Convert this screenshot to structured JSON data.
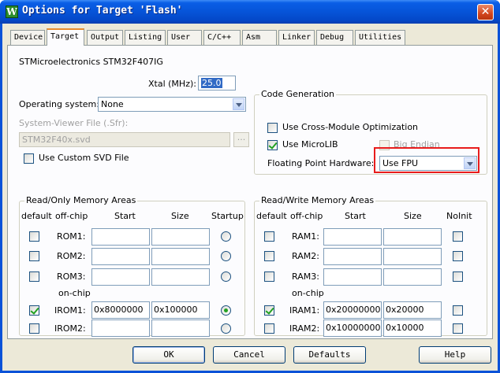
{
  "window": {
    "title": "Options for Target 'Flash'",
    "app_icon_letter": "W",
    "close_glyph": "✕"
  },
  "tabs": [
    "Device",
    "Target",
    "Output",
    "Listing",
    "User",
    "C/C++",
    "Asm",
    "Linker",
    "Debug",
    "Utilities"
  ],
  "active_tab": "Target",
  "device": {
    "name": "STMicroelectronics STM32F407IG"
  },
  "xtal": {
    "label": "Xtal (MHz):",
    "value": "25.0"
  },
  "os": {
    "label": "Operating system:",
    "value": "None"
  },
  "sfr": {
    "label": "System-Viewer File (.Sfr):",
    "value": "STM32F40x.svd",
    "browse_label": "...",
    "custom_svd_label": "Use Custom SVD File"
  },
  "code_generation": {
    "title": "Code Generation",
    "cross_module_label": "Use Cross-Module Optimization",
    "microlib_label": "Use MicroLIB",
    "big_endian_label": "Big Endian",
    "fpu_label": "Floating Point Hardware:",
    "fpu_value": "Use FPU"
  },
  "readonly_memory": {
    "title": "Read/Only Memory Areas",
    "headers": {
      "default": "default",
      "offchip": "off-chip",
      "start": "Start",
      "size": "Size",
      "startup": "Startup"
    },
    "onchip_label": "on-chip",
    "rows": [
      {
        "name": "ROM1:",
        "start": "",
        "size": "",
        "default": false,
        "startup": false
      },
      {
        "name": "ROM2:",
        "start": "",
        "size": "",
        "default": false,
        "startup": false
      },
      {
        "name": "ROM3:",
        "start": "",
        "size": "",
        "default": false,
        "startup": false
      },
      {
        "name": "IROM1:",
        "start": "0x8000000",
        "size": "0x100000",
        "default": true,
        "startup": true
      },
      {
        "name": "IROM2:",
        "start": "",
        "size": "",
        "default": false,
        "startup": false
      }
    ]
  },
  "readwrite_memory": {
    "title": "Read/Write Memory Areas",
    "headers": {
      "default": "default",
      "offchip": "off-chip",
      "start": "Start",
      "size": "Size",
      "noinit": "NoInit"
    },
    "onchip_label": "on-chip",
    "rows": [
      {
        "name": "RAM1:",
        "start": "",
        "size": "",
        "default": false,
        "noinit": false
      },
      {
        "name": "RAM2:",
        "start": "",
        "size": "",
        "default": false,
        "noinit": false
      },
      {
        "name": "RAM3:",
        "start": "",
        "size": "",
        "default": false,
        "noinit": false
      },
      {
        "name": "IRAM1:",
        "start": "0x20000000",
        "size": "0x20000",
        "default": true,
        "noinit": false
      },
      {
        "name": "IRAM2:",
        "start": "0x10000000",
        "size": "0x10000",
        "default": false,
        "noinit": false
      }
    ]
  },
  "buttons": {
    "ok": "OK",
    "cancel": "Cancel",
    "defaults": "Defaults",
    "help": "Help"
  },
  "colors": {
    "title_bar": "#0654d8",
    "dialog_bg": "#ece9d8",
    "highlight_box": "#e81c1c",
    "selection": "#316ac5",
    "check_mark": "#21a121"
  }
}
